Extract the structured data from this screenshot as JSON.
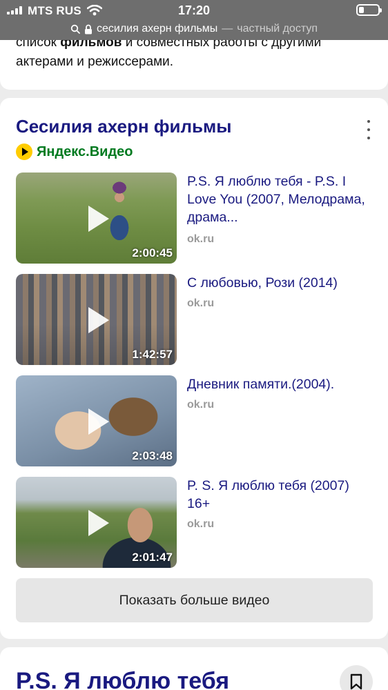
{
  "status_bar": {
    "carrier": "MTS RUS",
    "time": "17:20"
  },
  "url_bar": {
    "query": "сесилия ахерн фильмы",
    "separator": "—",
    "mode": "частный доступ"
  },
  "top_card": {
    "text_before": "список ",
    "text_bold": "фильмов",
    "text_after": " и совместных работы с другими актерами и режиссерами."
  },
  "video_card": {
    "title": "Сесилия ахерн фильмы",
    "source": "Яндекс.Видео",
    "videos": [
      {
        "title": "P.S. Я люблю тебя - P.S. I Love You (2007, Мелодрама, драма...",
        "host": "ok.ru",
        "duration": "2:00:45"
      },
      {
        "title": "С любовью, Рози (2014)",
        "host": "ok.ru",
        "duration": "1:42:57"
      },
      {
        "title": "Дневник памяти.(2004).",
        "host": "ok.ru",
        "duration": "2:03:48"
      },
      {
        "title": "P. S. Я люблю тебя (2007) 16+",
        "host": "ok.ru",
        "duration": "2:01:47"
      }
    ],
    "more_button": "Показать больше видео"
  },
  "bottom_card": {
    "title": "P.S. Я люблю тебя"
  },
  "icons": [
    "signal-icon",
    "wifi-icon",
    "battery-icon",
    "search-icon",
    "lock-icon",
    "more-options-icon",
    "yandex-video-icon",
    "play-icon",
    "bookmark-icon"
  ]
}
